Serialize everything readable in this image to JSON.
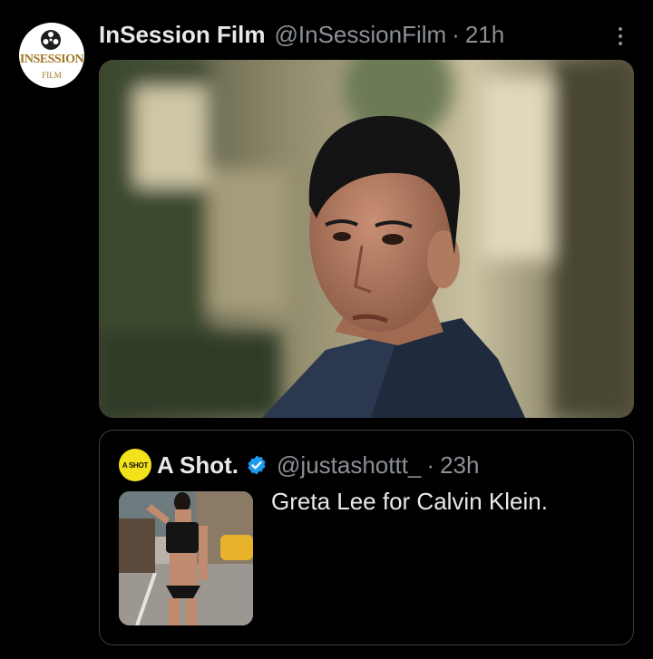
{
  "tweet": {
    "author": {
      "name": "InSession Film",
      "handle": "@InSessionFilm",
      "time": "21h",
      "avatar_text": "INSESSION",
      "avatar_sub": "FILM"
    },
    "separator": "·",
    "media": {
      "description": "photo-man-looking-back",
      "icon": "photo"
    },
    "quoted": {
      "author": {
        "name": "A Shot.",
        "handle": "@justashottt_",
        "time": "23h",
        "avatar_text": "A SHOT",
        "verified": true
      },
      "text": "Greta Lee for Calvin Klein."
    }
  },
  "colors": {
    "background": "#000000",
    "text_primary": "#e7e9ea",
    "text_secondary": "#8b9096",
    "border": "#3a3d41",
    "verified_blue": "#1d9bf0",
    "logo_gold": "#a2761f",
    "quote_avatar_yellow": "#f3e11b"
  }
}
